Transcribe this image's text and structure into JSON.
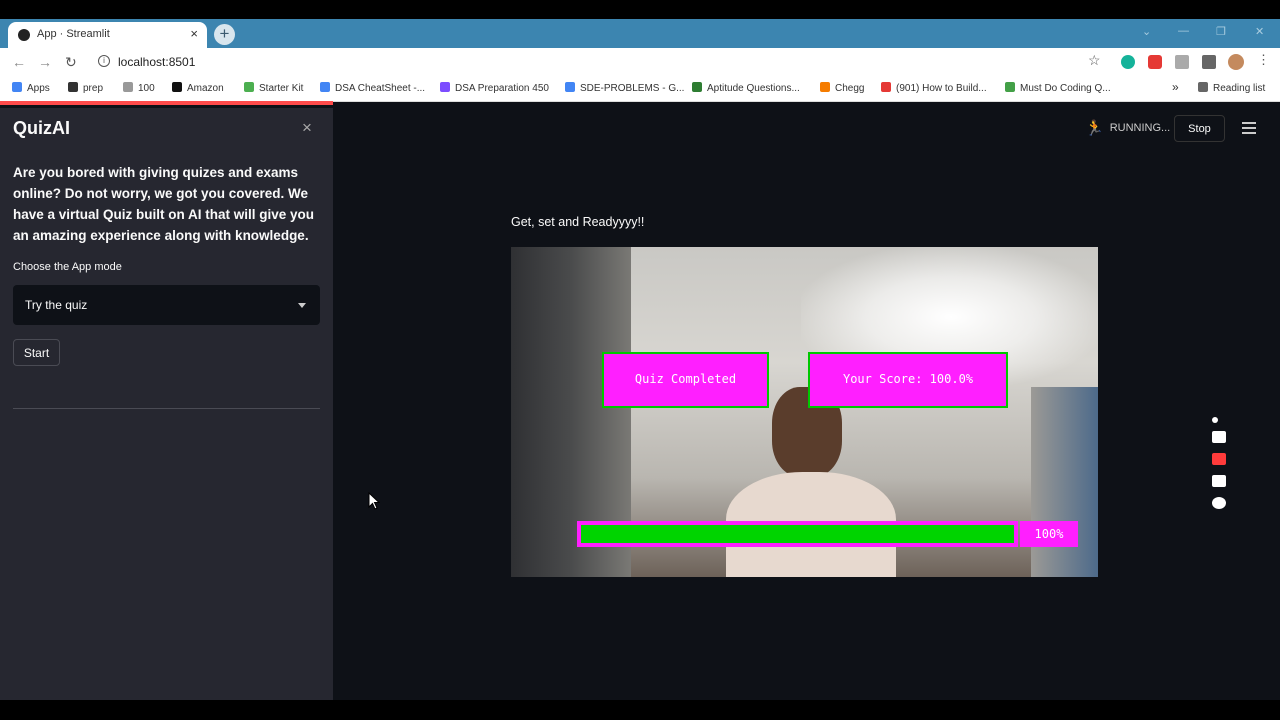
{
  "browser": {
    "tab_title": "App · Streamlit",
    "tab_close": "×",
    "new_tab": "+",
    "url": "localhost:8501",
    "window_controls": [
      "⌄",
      "—",
      "❐",
      "✕"
    ]
  },
  "bookmarks": [
    {
      "label": "Apps",
      "color": "#4285f4"
    },
    {
      "label": "prep",
      "color": "#333333"
    },
    {
      "label": "100",
      "color": "#999999"
    },
    {
      "label": "Amazon",
      "color": "#111111"
    },
    {
      "label": "Starter Kit",
      "color": "#4caf50"
    },
    {
      "label": "DSA CheatSheet -...",
      "color": "#4285f4"
    },
    {
      "label": "DSA Preparation 450",
      "color": "#7c4dff"
    },
    {
      "label": "SDE-PROBLEMS - G...",
      "color": "#4285f4"
    },
    {
      "label": "Aptitude Questions...",
      "color": "#2e7d32"
    },
    {
      "label": "Chegg",
      "color": "#f57c00"
    },
    {
      "label": "(901) How to Build...",
      "color": "#e53935"
    },
    {
      "label": "Must Do Coding Q...",
      "color": "#43a047"
    }
  ],
  "bookmarks_more": "»",
  "reading_list": "Reading list",
  "sidebar": {
    "close": "×",
    "title": "QuizAI",
    "description": "Are you bored with giving quizes and exams online? Do not worry, we got you covered. We have a virtual Quiz built on AI that will give you an amazing experience along with knowledge.",
    "mode_label": "Choose the App mode",
    "mode_value": "Try the quiz",
    "start_label": "Start"
  },
  "header": {
    "status": "RUNNING...",
    "stop_label": "Stop"
  },
  "main": {
    "heading": "Get, set and Readyyyy!!",
    "overlay_complete": "Quiz Completed",
    "overlay_score": "Your Score: 100.0%",
    "progress": 1.0,
    "progress_label": "100%"
  },
  "colors": {
    "overlay_bg": "#ff1fff",
    "overlay_border": "#00c800",
    "progress_fill": "#00d400",
    "accent": "#ff4b4b",
    "app_bg": "#0e1117",
    "sidebar_bg": "#262730"
  }
}
